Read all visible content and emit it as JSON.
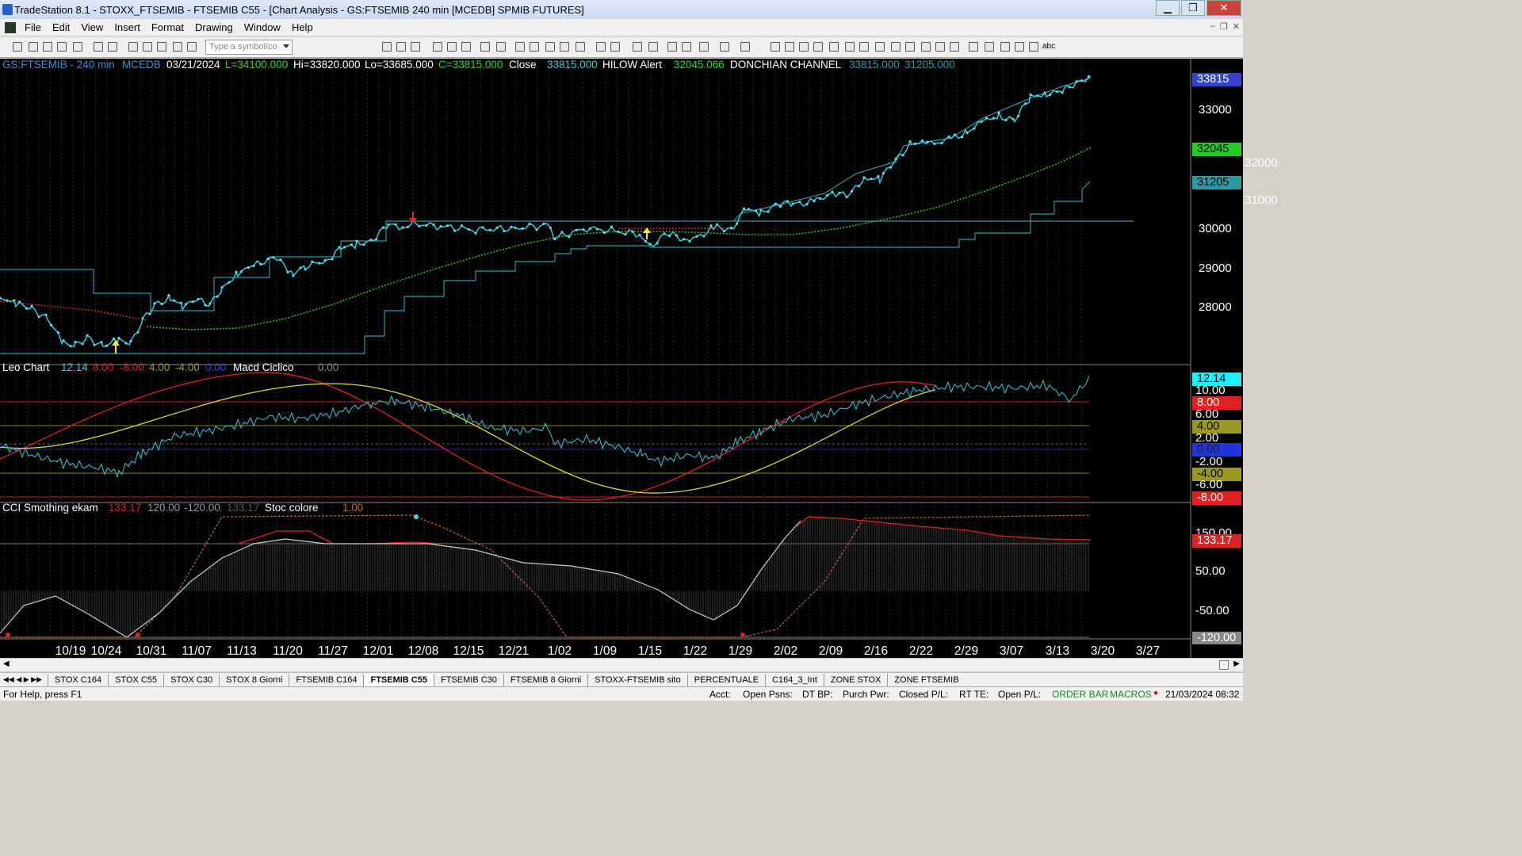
{
  "window": {
    "title": "TradeStation 8.1 - STOXX_FTSEMIB - FTSEMIB C55 - [Chart Analysis - GS:FTSEMIB  240 min  [MCEDB] SPMIB FUTURES]"
  },
  "menu": [
    "File",
    "Edit",
    "View",
    "Insert",
    "Format",
    "Drawing",
    "Window",
    "Help"
  ],
  "toolbar": {
    "symbol_placeholder": "Type a symbol/co",
    "text_tool": "abc"
  },
  "header": {
    "symbol": "GS:FTSEMIB - 240 min",
    "source": "MCEDB",
    "date": "03/21/2024",
    "low_open": "L=34100.000",
    "hi": "Hi=33820.000",
    "lo": "Lo=33685.000",
    "close_val": "C=33815.000",
    "close_label": "Close",
    "close_num": "33815.000",
    "hilow": "HILOW Alert",
    "hilow_val": "32045.066",
    "donchian": "DONCHIAN CHANNEL",
    "don1": "33815.000",
    "don2": "31205.000"
  },
  "price_axis": {
    "ticks": [
      "33000",
      "32000",
      "31000",
      "30000",
      "29000",
      "28000"
    ],
    "last": "33815",
    "green_box": "32045",
    "teal_box": "31205"
  },
  "leo": {
    "name": "Leo Chart",
    "v1": "12.14",
    "v2": "8.00",
    "v3": "-8.00",
    "v4": "4.00",
    "v5": "-4.00",
    "v6": "0.00",
    "macd": "Macd Ciclico",
    "macd_val": "0.00"
  },
  "leo_axis": {
    "b1": "12.14",
    "t1": "10.00",
    "b2": "8.00",
    "t2": "6.00",
    "b3": "4.00",
    "t3": "2.00",
    "b4": "0.00",
    "t4": "-2.00",
    "b5": "-4.00",
    "t5": "-6.00",
    "b6": "-8.00"
  },
  "cci": {
    "name": "CCI Smothing ekam",
    "v1": "133.17",
    "v2": "120.00",
    "v3": "-120.00",
    "v4": "133.17",
    "stoc": "Stoc colore",
    "stoc_val": "1.00"
  },
  "cci_axis": {
    "t1": "150.00",
    "box": "133.17",
    "t2": "50.00",
    "t3": "-50.00",
    "t4": "-120.00"
  },
  "dates": [
    "10/19",
    "10/24",
    "10/31",
    "11/07",
    "11/13",
    "11/20",
    "11/27",
    "12/01",
    "12/08",
    "12/15",
    "12/21",
    "1/02",
    "1/09",
    "1/15",
    "1/22",
    "1/29",
    "2/02",
    "2/09",
    "2/16",
    "2/22",
    "2/29",
    "3/07",
    "3/13",
    "3/20",
    "3/27"
  ],
  "tabs": [
    "STOX C164",
    "STOX C55",
    "STOX  C30",
    "STOX  8 Giorni",
    "FTSEMIB C164",
    "FTSEMIB C55",
    "FTSEMIB C30",
    "FTSEMIB  8 Giorni",
    "STOXX-FTSEMIB sito",
    "PERCENTUALE",
    "C164_3_Int",
    "ZONE STOX",
    "ZONE FTSEMIB"
  ],
  "status": {
    "help": "For Help, press F1",
    "acct": "Acct:",
    "open_psns": "Open Psns:",
    "dtbp": "DT BP:",
    "purch": "Purch Pwr:",
    "closed": "Closed P/L:",
    "rtte": "RT TE:",
    "openpl": "Open P/L:",
    "order": "ORDER BAR",
    "macros": "MACROS",
    "datetime": "21/03/2024 08:32"
  },
  "colors": {
    "price": "#33ccdd",
    "hilow": "#22cc22",
    "donchian": "#2a9aa8",
    "red": "#dd2222",
    "yellow": "#dddd22"
  }
}
